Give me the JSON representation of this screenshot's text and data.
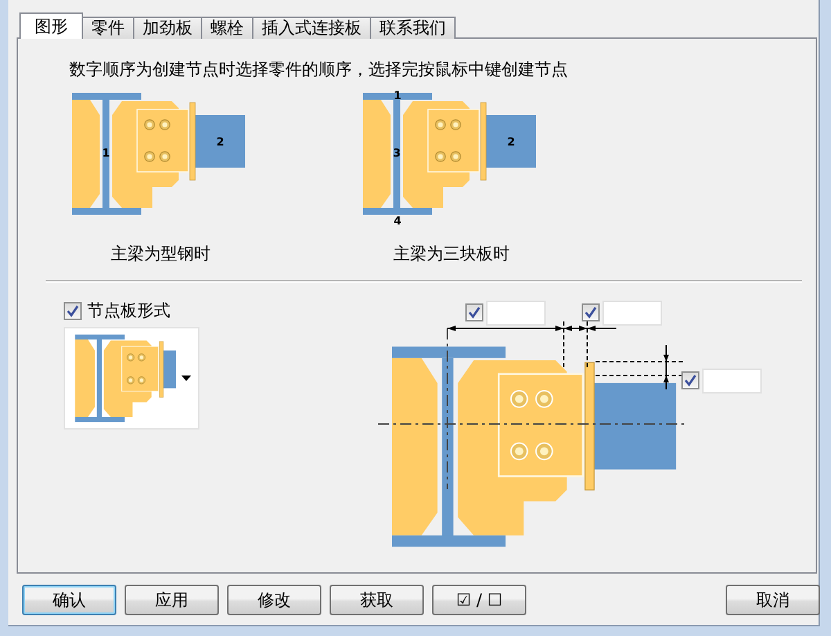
{
  "tabs": [
    {
      "label": "图形",
      "selected": true
    },
    {
      "label": "零件",
      "selected": false
    },
    {
      "label": "加劲板",
      "selected": false
    },
    {
      "label": "螺栓",
      "selected": false
    },
    {
      "label": "插入式连接板",
      "selected": false
    },
    {
      "label": "联系我们",
      "selected": false
    }
  ],
  "instruction": "数字顺序为创建节点时选择零件的顺序，选择完按鼠标中键创建节点",
  "diagrams": [
    {
      "caption": "主梁为型钢时",
      "kind": "rolled",
      "labels": [
        "1",
        "2"
      ]
    },
    {
      "caption": "主梁为三块板时",
      "kind": "plates",
      "labels": [
        "1",
        "3",
        "4",
        "2"
      ]
    }
  ],
  "gusset_style": {
    "label": "节点板形式",
    "checked": true
  },
  "dimension_fields": [
    {
      "checked": true
    },
    {
      "checked": true
    },
    {
      "checked": true
    }
  ],
  "buttons": [
    {
      "label": "确认",
      "kind": "default"
    },
    {
      "label": "应用",
      "kind": "normal"
    },
    {
      "label": "修改",
      "kind": "normal"
    },
    {
      "label": "获取",
      "kind": "normal"
    },
    {
      "label": "☑ / ☐",
      "kind": "toggle"
    },
    {
      "label": "取消",
      "kind": "cancel"
    }
  ]
}
